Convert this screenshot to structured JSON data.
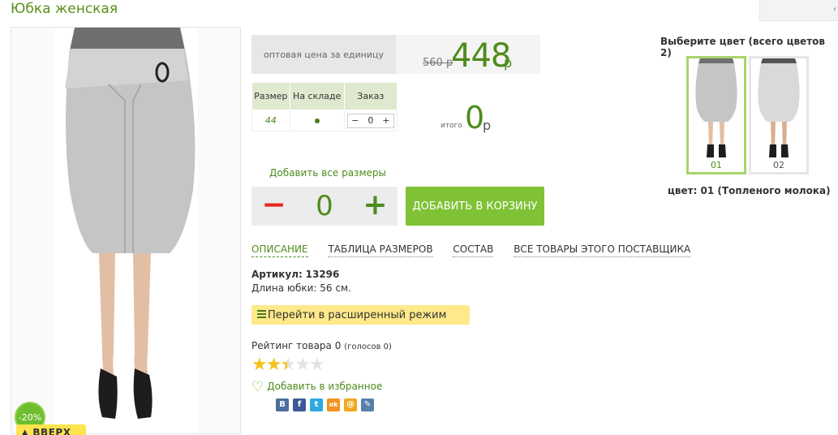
{
  "product": {
    "title": "Юбка женская",
    "discount_badge": "-20%",
    "up_button": "ВВЕРХ"
  },
  "price": {
    "label": "оптовая цена за единицу",
    "old": "560 р",
    "current": "448",
    "currency": "р"
  },
  "sizes_table": {
    "headers": [
      "Размер",
      "На складе",
      "Заказ"
    ],
    "rows": [
      {
        "size": "44",
        "in_stock": true,
        "qty": "0"
      }
    ],
    "minus": "−",
    "plus": "+"
  },
  "total": {
    "label": "итого",
    "value": "0",
    "currency": "р"
  },
  "add_all_sizes": "Добавить все размеры",
  "quantity": {
    "minus": "−",
    "value": "0",
    "plus": "+"
  },
  "add_to_cart": "ДОБАВИТЬ В КОРЗИНУ",
  "tabs": [
    {
      "label": "ОПИСАНИЕ",
      "active": true
    },
    {
      "label": "ТАБЛИЦА РАЗМЕРОВ",
      "active": false
    },
    {
      "label": "СОСТАВ",
      "active": false
    },
    {
      "label": "ВСЕ ТОВАРЫ ЭТОГО ПОСТАВЩИКА",
      "active": false
    }
  ],
  "description": {
    "sku_label": "Артикул:",
    "sku_value": "13296",
    "length": "Длина юбки: 56 см."
  },
  "advanced_mode": "Перейти в расширенный режим",
  "rating": {
    "label": "Рейтинг товара 0",
    "votes": "(голосов 0)",
    "stars_filled": 2.5,
    "stars_total": 5
  },
  "favorite": "Добавить в избранное",
  "social": [
    {
      "icon": "vk-icon",
      "glyph": "В",
      "color": "#4a6f9c"
    },
    {
      "icon": "facebook-icon",
      "glyph": "f",
      "color": "#3b5998"
    },
    {
      "icon": "twitter-icon",
      "glyph": "t",
      "color": "#2fa9e0"
    },
    {
      "icon": "odnoklassniki-icon",
      "glyph": "ok",
      "color": "#f39320"
    },
    {
      "icon": "mailru-icon",
      "glyph": "@",
      "color": "#f2a71e"
    },
    {
      "icon": "livejournal-icon",
      "glyph": "✎",
      "color": "#5a7fa8"
    }
  ],
  "colors": {
    "title": "Выберите цвет (всего цветов 2)",
    "options": [
      {
        "code": "01",
        "selected": true
      },
      {
        "code": "02",
        "selected": false
      }
    ],
    "selected_name": "цвет: 01 (Топленого молока)"
  },
  "corner_tab": "‹"
}
